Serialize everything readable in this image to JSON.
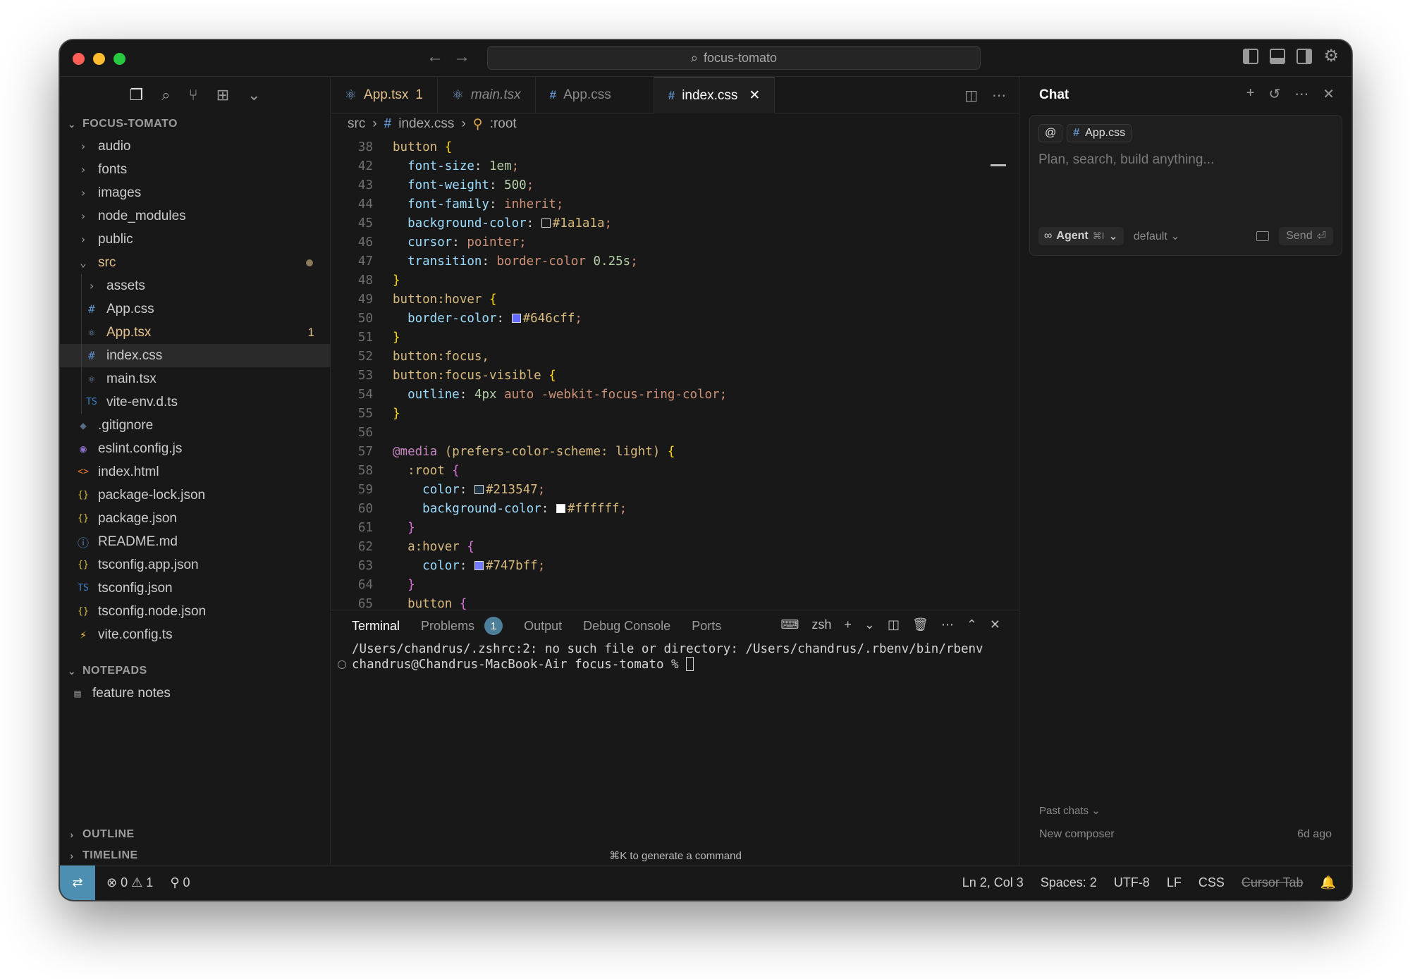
{
  "search": {
    "value": "focus-tomato"
  },
  "sidebar": {
    "project": "FOCUS-TOMATO",
    "items": [
      {
        "label": "audio",
        "icon": "chevron-right",
        "kind": "folder"
      },
      {
        "label": "fonts",
        "icon": "chevron-right",
        "kind": "folder"
      },
      {
        "label": "images",
        "icon": "chevron-right",
        "kind": "folder"
      },
      {
        "label": "node_modules",
        "icon": "chevron-right",
        "kind": "folder"
      },
      {
        "label": "public",
        "icon": "chevron-right",
        "kind": "folder"
      },
      {
        "label": "src",
        "icon": "chevron-down",
        "kind": "folder-open"
      },
      {
        "label": "assets",
        "icon": "chevron-right",
        "kind": "folder"
      },
      {
        "label": "App.css",
        "icon": "#",
        "kind": "css"
      },
      {
        "label": "App.tsx",
        "icon": "react",
        "kind": "tsx",
        "badge": "1"
      },
      {
        "label": "index.css",
        "icon": "#",
        "kind": "css"
      },
      {
        "label": "main.tsx",
        "icon": "react",
        "kind": "tsx"
      },
      {
        "label": "vite-env.d.ts",
        "icon": "TS",
        "kind": "ts"
      },
      {
        "label": ".gitignore",
        "icon": "git",
        "kind": "file"
      },
      {
        "label": "eslint.config.js",
        "icon": "eslint",
        "kind": "file"
      },
      {
        "label": "index.html",
        "icon": "<>",
        "kind": "file"
      },
      {
        "label": "package-lock.json",
        "icon": "{}",
        "kind": "json"
      },
      {
        "label": "package.json",
        "icon": "{}",
        "kind": "json"
      },
      {
        "label": "README.md",
        "icon": "info",
        "kind": "file"
      },
      {
        "label": "tsconfig.app.json",
        "icon": "{}",
        "kind": "json"
      },
      {
        "label": "tsconfig.json",
        "icon": "TS",
        "kind": "json"
      },
      {
        "label": "tsconfig.node.json",
        "icon": "{}",
        "kind": "json"
      },
      {
        "label": "vite.config.ts",
        "icon": "bolt",
        "kind": "file"
      }
    ],
    "notepads_header": "NOTEPADS",
    "notepad_item": "feature notes",
    "outline_header": "OUTLINE",
    "timeline_header": "TIMELINE"
  },
  "tabs": [
    {
      "label": "App.tsx",
      "badge": "1"
    },
    {
      "label": "main.tsx"
    },
    {
      "label": "App.css"
    },
    {
      "label": "index.css"
    }
  ],
  "breadcrumb": {
    "part1": "src",
    "part2": "index.css",
    "part3": ":root"
  },
  "code_lines": [
    {
      "n": "38",
      "t": "button {"
    },
    {
      "n": "42",
      "t": "  font-size: 1em;"
    },
    {
      "n": "43",
      "t": "  font-weight: 500;"
    },
    {
      "n": "44",
      "t": "  font-family: inherit;"
    },
    {
      "n": "45",
      "t": "  background-color: #1a1a1a;"
    },
    {
      "n": "46",
      "t": "  cursor: pointer;"
    },
    {
      "n": "47",
      "t": "  transition: border-color 0.25s;"
    },
    {
      "n": "48",
      "t": "}"
    },
    {
      "n": "49",
      "t": "button:hover {"
    },
    {
      "n": "50",
      "t": "  border-color: #646cff;"
    },
    {
      "n": "51",
      "t": "}"
    },
    {
      "n": "52",
      "t": "button:focus,"
    },
    {
      "n": "53",
      "t": "button:focus-visible {"
    },
    {
      "n": "54",
      "t": "  outline: 4px auto -webkit-focus-ring-color;"
    },
    {
      "n": "55",
      "t": "}"
    },
    {
      "n": "56",
      "t": ""
    },
    {
      "n": "57",
      "t": "@media (prefers-color-scheme: light) {"
    },
    {
      "n": "58",
      "t": "  :root {"
    },
    {
      "n": "59",
      "t": "    color: #213547;"
    },
    {
      "n": "60",
      "t": "    background-color: #ffffff;"
    },
    {
      "n": "61",
      "t": "  }"
    },
    {
      "n": "62",
      "t": "  a:hover {"
    },
    {
      "n": "63",
      "t": "    color: #747bff;"
    },
    {
      "n": "64",
      "t": "  }"
    },
    {
      "n": "65",
      "t": "  button {"
    }
  ],
  "panel": {
    "tabs": [
      "Terminal",
      "Problems",
      "Output",
      "Debug Console",
      "Ports"
    ],
    "problems_count": "1",
    "shell": "zsh",
    "terminal_line1": "/Users/chandrus/.zshrc:2: no such file or directory: /Users/chandrus/.rbenv/bin/rbenv",
    "terminal_line2": "chandrus@Chandrus-MacBook-Air focus-tomato % ",
    "hint": "⌘K to generate a command"
  },
  "chat": {
    "title": "Chat",
    "context_chip": "App.css",
    "placeholder": "Plan, search, build anything...",
    "agent_label": "Agent",
    "agent_shortcut": "⌘I",
    "model": "default",
    "send": "Send",
    "past_chats": "Past chats",
    "recent_title": "New composer",
    "recent_time": "6d ago"
  },
  "status": {
    "errors": "0",
    "warnings": "1",
    "ports": "0",
    "position": "Ln 2, Col 3",
    "spaces": "Spaces: 2",
    "encoding": "UTF-8",
    "eol": "LF",
    "language": "CSS",
    "cursor_tab": "Cursor Tab"
  },
  "colors": {
    "window_bg": "#181818",
    "accent": "#4d8fb0",
    "warning": "#e2c08d",
    "css_icon": "#5d8fc9"
  }
}
